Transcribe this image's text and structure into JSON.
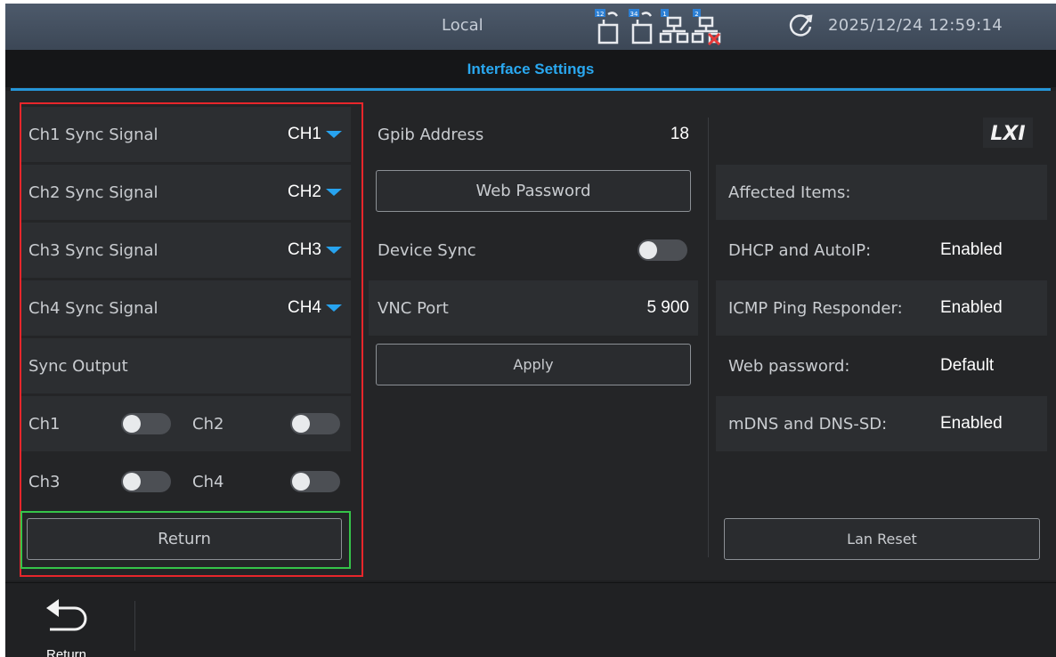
{
  "status": {
    "mode": "Local",
    "datetime": "2025/12/24 12:59:14",
    "icons": [
      "usb-port-12-icon",
      "usb-port-34-icon",
      "lan-1-icon",
      "lan-2-disconnected-icon",
      "gauge-icon"
    ],
    "badges": [
      "12",
      "34",
      "1",
      "2"
    ]
  },
  "title": "Interface Settings",
  "sync": {
    "rows": [
      {
        "label": "Ch1 Sync Signal",
        "value": "CH1"
      },
      {
        "label": "Ch2 Sync Signal",
        "value": "CH2"
      },
      {
        "label": "Ch3 Sync Signal",
        "value": "CH3"
      },
      {
        "label": "Ch4 Sync Signal",
        "value": "CH4"
      }
    ],
    "output_label": "Sync Output",
    "toggles": [
      {
        "label": "Ch1",
        "on": false
      },
      {
        "label": "Ch2",
        "on": false
      },
      {
        "label": "Ch3",
        "on": false
      },
      {
        "label": "Ch4",
        "on": false
      }
    ],
    "return_label": "Return"
  },
  "interface": {
    "gpib_label": "Gpib Address",
    "gpib_value": "18",
    "web_password_label": "Web Password",
    "device_sync_label": "Device Sync",
    "device_sync_on": false,
    "vnc_label": "VNC Port",
    "vnc_value": "5 900",
    "apply_label": "Apply"
  },
  "lxi": {
    "logo": "LXI",
    "affected_label": "Affected Items:",
    "items": [
      {
        "label": "DHCP and AutoIP:",
        "value": "Enabled"
      },
      {
        "label": "ICMP Ping Responder:",
        "value": "Enabled"
      },
      {
        "label": "Web password:",
        "value": "Default"
      },
      {
        "label": "mDNS and DNS-SD:",
        "value": "Enabled"
      }
    ],
    "lan_reset_label": "Lan Reset"
  },
  "softkey": {
    "return_label": "Return"
  },
  "colors": {
    "accent": "#2aa8f0",
    "highlight_red": "#e8262b",
    "highlight_green": "#35c449"
  }
}
